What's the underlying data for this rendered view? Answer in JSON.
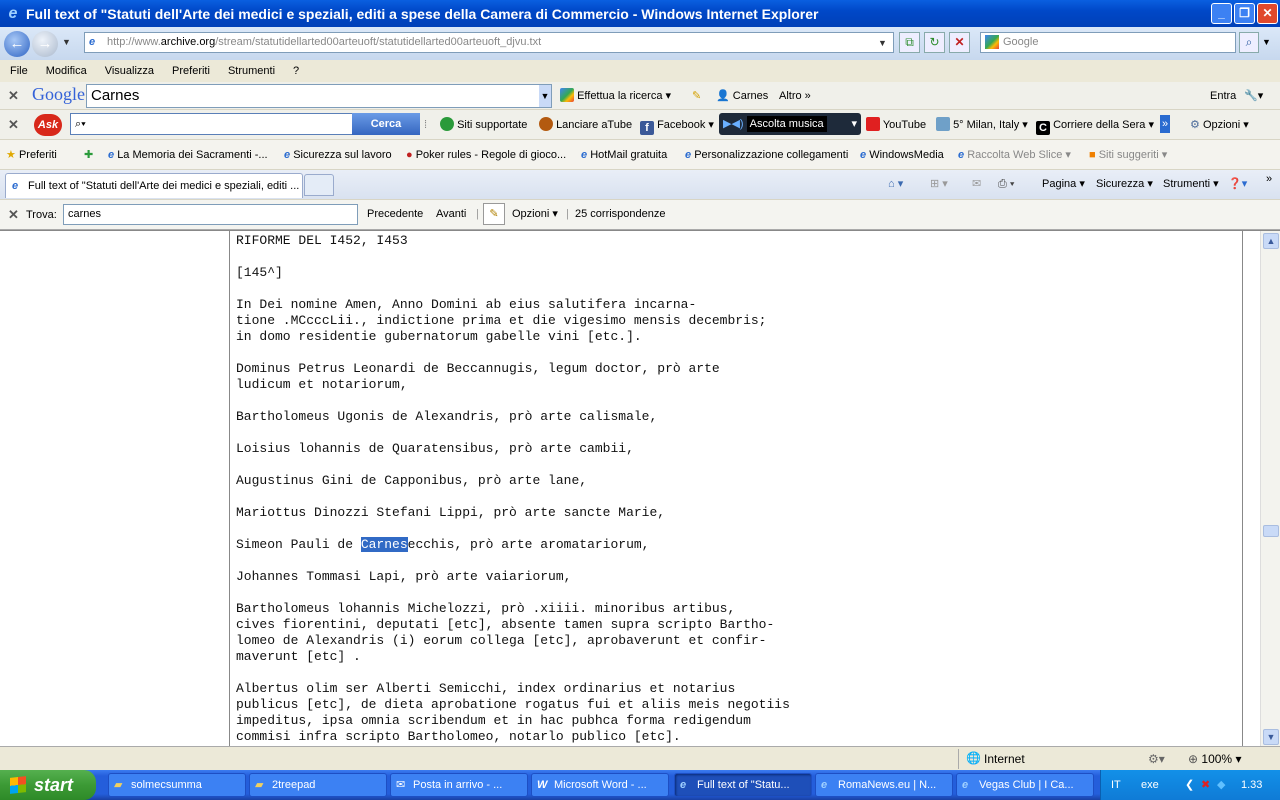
{
  "window": {
    "title": "Full text of \"Statuti dell'Arte dei medici e speziali, editi a spese della Camera di Commercio  - Windows Internet Explorer",
    "minimize_icon": "minimize-icon",
    "maximize_icon": "maximize-icon",
    "close_icon": "close-icon"
  },
  "address": {
    "url_prefix": "http://www.",
    "url_domain": "archive.org",
    "url_path": "/stream/statutidellarted00arteuoft/statutidellarted00arteuoft_djvu.txt",
    "search_placeholder": "Google"
  },
  "menu": [
    "File",
    "Modifica",
    "Visualizza",
    "Preferiti",
    "Strumenti",
    "?"
  ],
  "google_toolbar": {
    "logo": "Google",
    "query": "Carnes",
    "search_button": "Effettua la ricerca",
    "highlight_word": "Carnes",
    "more": "Altro",
    "signin": "Entra"
  },
  "ask_toolbar": {
    "logo": "Ask",
    "search_button": "Cerca",
    "items": [
      "Siti supportate",
      "Lanciare aTube",
      "Facebook",
      "Ascolta musica",
      "YouTube",
      "5° Milan, Italy",
      "Corriere della Sera",
      "Opzioni"
    ]
  },
  "favorites_bar": {
    "favorites": "Preferiti",
    "items": [
      "La Memoria dei Sacramenti -...",
      "Sicurezza sul lavoro",
      "Poker rules - Regole di gioco...",
      "HotMail gratuita",
      "Personalizzazione collegamenti",
      "WindowsMedia",
      "Raccolta Web Slice",
      "Siti suggeriti"
    ]
  },
  "tabs": {
    "active": "Full text of \"Statuti dell'Arte dei medici e speziali, editi ...",
    "commands": [
      "Pagina",
      "Sicurezza",
      "Strumenti"
    ]
  },
  "find_bar": {
    "label": "Trova:",
    "value": "carnes",
    "previous": "Precedente",
    "next": "Avanti",
    "options": "Opzioni",
    "matches": "25 corrispondenze"
  },
  "document": {
    "lines_before": "RIFORME DEL I452, I453\n\n[145^]\n\nIn Dei nomine Amen, Anno Domini ab eius salutifera incarna-\ntione .MCcccLii., indictione prima et die vigesimo mensis decembris;\nin domo residentie gubernatorum gabelle vini [etc.].\n\nDominus Petrus Leonardi de Beccannugis, legum doctor, prò arte\nludicum et notariorum,\n\nBartholomeus Ugonis de Alexandris, prò arte calismale,\n\nLoisius lohannis de Quaratensibus, prò arte cambii,\n\nAugustinus Gini de Capponibus, prò arte lane,\n\nMariottus Dinozzi Stefani Lippi, prò arte sancte Marie,\n\n",
    "match_line_start": "Simeon Pauli de ",
    "match_word": "Carnes",
    "match_line_end": "ecchis, prò arte aromatariorum,",
    "lines_after": "\n\nJohannes Tommasi Lapi, prò arte vaiariorum,\n\nBartholomeus lohannis Michelozzi, prò .xiiii. minoribus artibus,\ncives fiorentini, deputati [etc], absente tamen supra scripto Bartho-\nlomeo de Alexandris (i) eorum collega [etc], aprobaverunt et confir-\nmaverunt [etc] .\n\nAlbertus olim ser Alberti Semicchi, index ordinarius et notarius\npublicus [etc], de dieta aprobatione rogatus fui et aliis meis negotiis\nimpeditus, ipsa omnia scribendum et in hac pubhca forma redigendum\ncommisi infra scripto Bartholomeo, notarlo publico [etc]."
  },
  "status": {
    "zone": "Internet",
    "zoom": "100%"
  },
  "taskbar": {
    "start": "start",
    "items": [
      "solmecsumma",
      "2treepad",
      "Posta in arrivo - ...",
      "Microsoft Word - ...",
      "Full text of \"Statu...",
      "RomaNews.eu | N...",
      "Vegas Club | I Ca..."
    ],
    "lang": "IT",
    "tray_text": "exe",
    "clock": "1.33"
  }
}
